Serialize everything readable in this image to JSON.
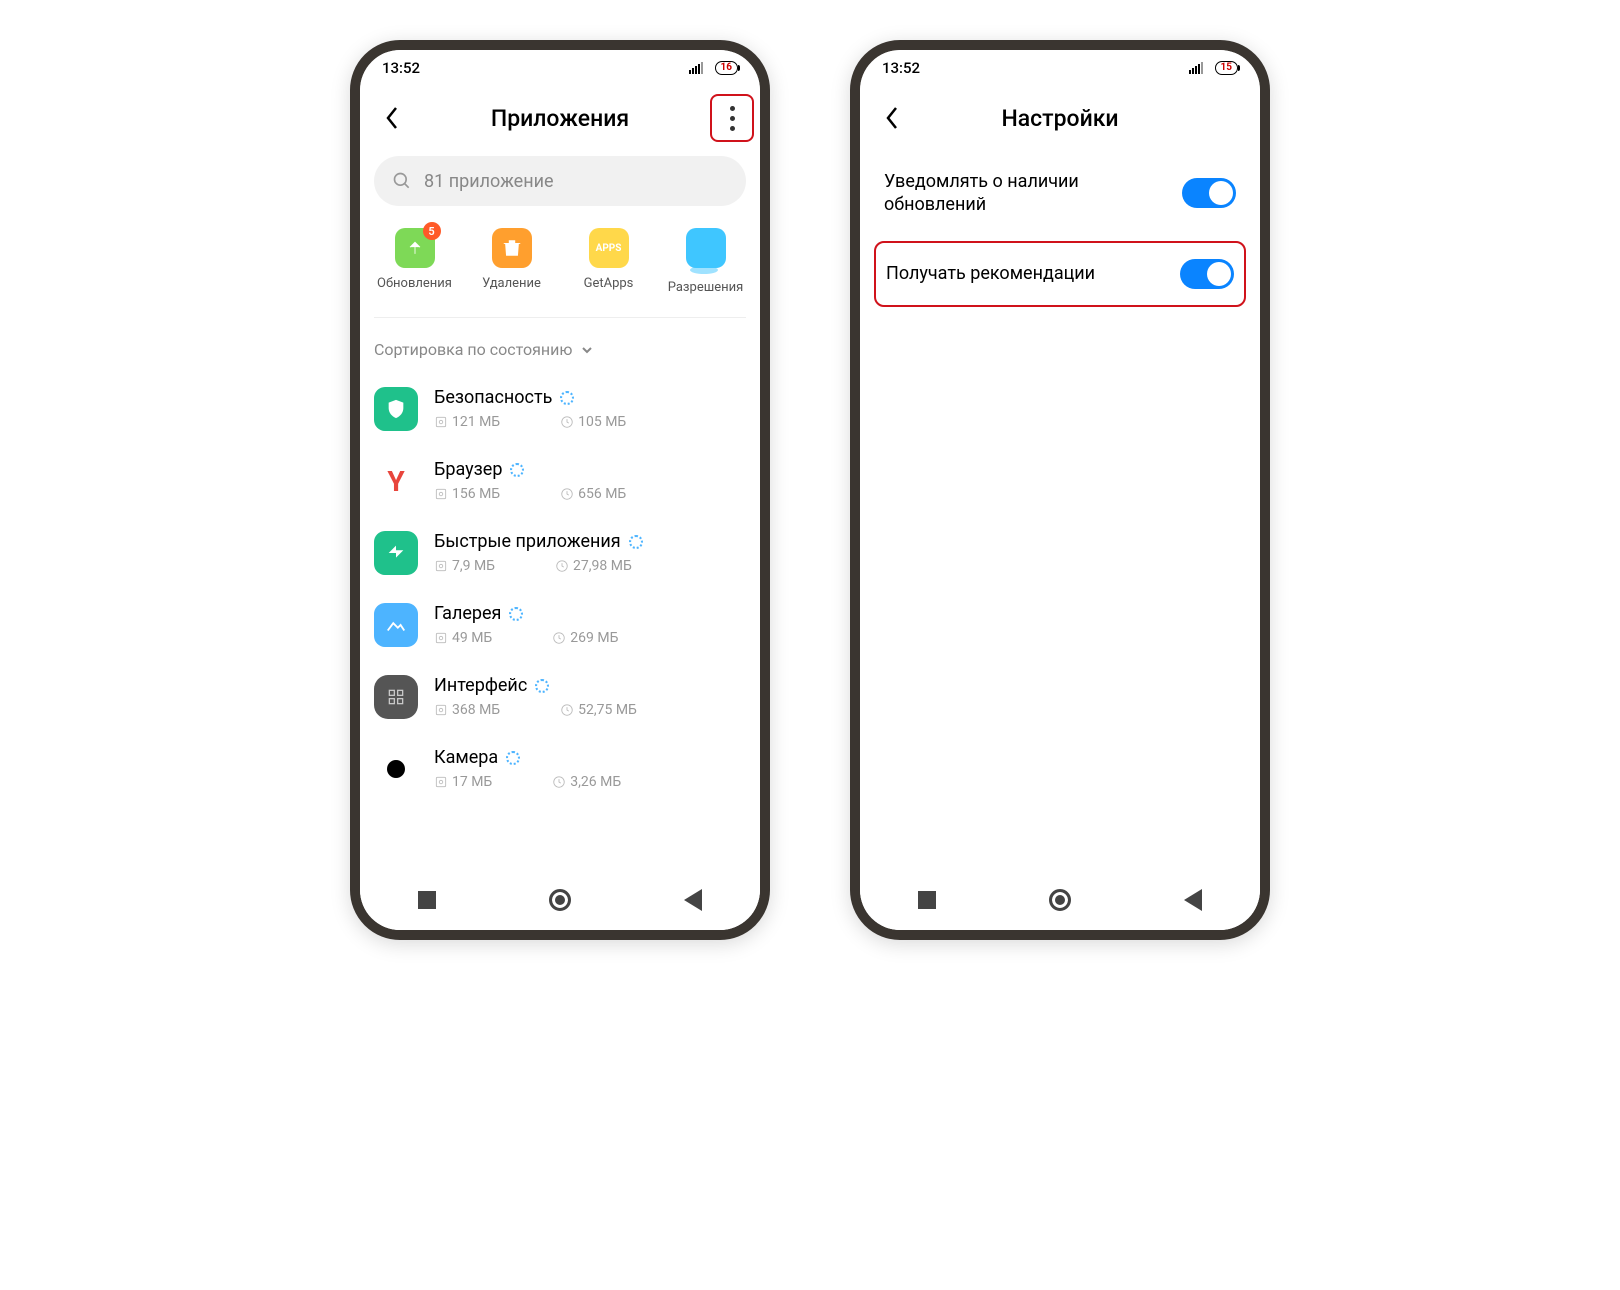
{
  "left": {
    "status_time": "13:52",
    "battery": "16",
    "title": "Приложения",
    "search_placeholder": "81 приложение",
    "shortcuts": {
      "update": "Обновления",
      "update_badge": "5",
      "delete": "Удаление",
      "getapps": "GetApps",
      "perm": "Разрешения"
    },
    "sort_label": "Сортировка по состоянию",
    "apps": [
      {
        "name": "Безопасность",
        "storage": "121 МБ",
        "clock": "105 МБ"
      },
      {
        "name": "Браузер",
        "storage": "156 МБ",
        "clock": "656 МБ"
      },
      {
        "name": "Быстрые приложения",
        "storage": "7,9 МБ",
        "clock": "27,98 МБ"
      },
      {
        "name": "Галерея",
        "storage": "49 МБ",
        "clock": "269 МБ"
      },
      {
        "name": "Интерфейс",
        "storage": "368 МБ",
        "clock": "52,75 МБ"
      },
      {
        "name": "Камера",
        "storage": "17 МБ",
        "clock": "3,26 МБ"
      }
    ]
  },
  "right": {
    "status_time": "13:52",
    "battery": "15",
    "title": "Настройки",
    "settings": {
      "notify_updates": "Уведомлять о наличии обновлений",
      "recommendations": "Получать рекомендации"
    }
  }
}
